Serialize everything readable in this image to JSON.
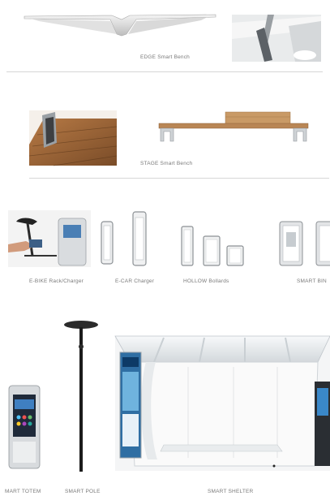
{
  "sections": {
    "edge": {
      "caption": "EDGE Smart Bench"
    },
    "stage": {
      "caption": "STAGE Smart Bench"
    },
    "row3": {
      "ebike": "E-BIKE Rack/Charger",
      "ecar": "E-CAR Charger",
      "hollow": "HOLLOW Bollards",
      "smartbin": "SMART BIN"
    },
    "row4": {
      "totem": "MART TOTEM",
      "pole": "SMART POLE",
      "shelter": "SMART SHELTER"
    }
  }
}
